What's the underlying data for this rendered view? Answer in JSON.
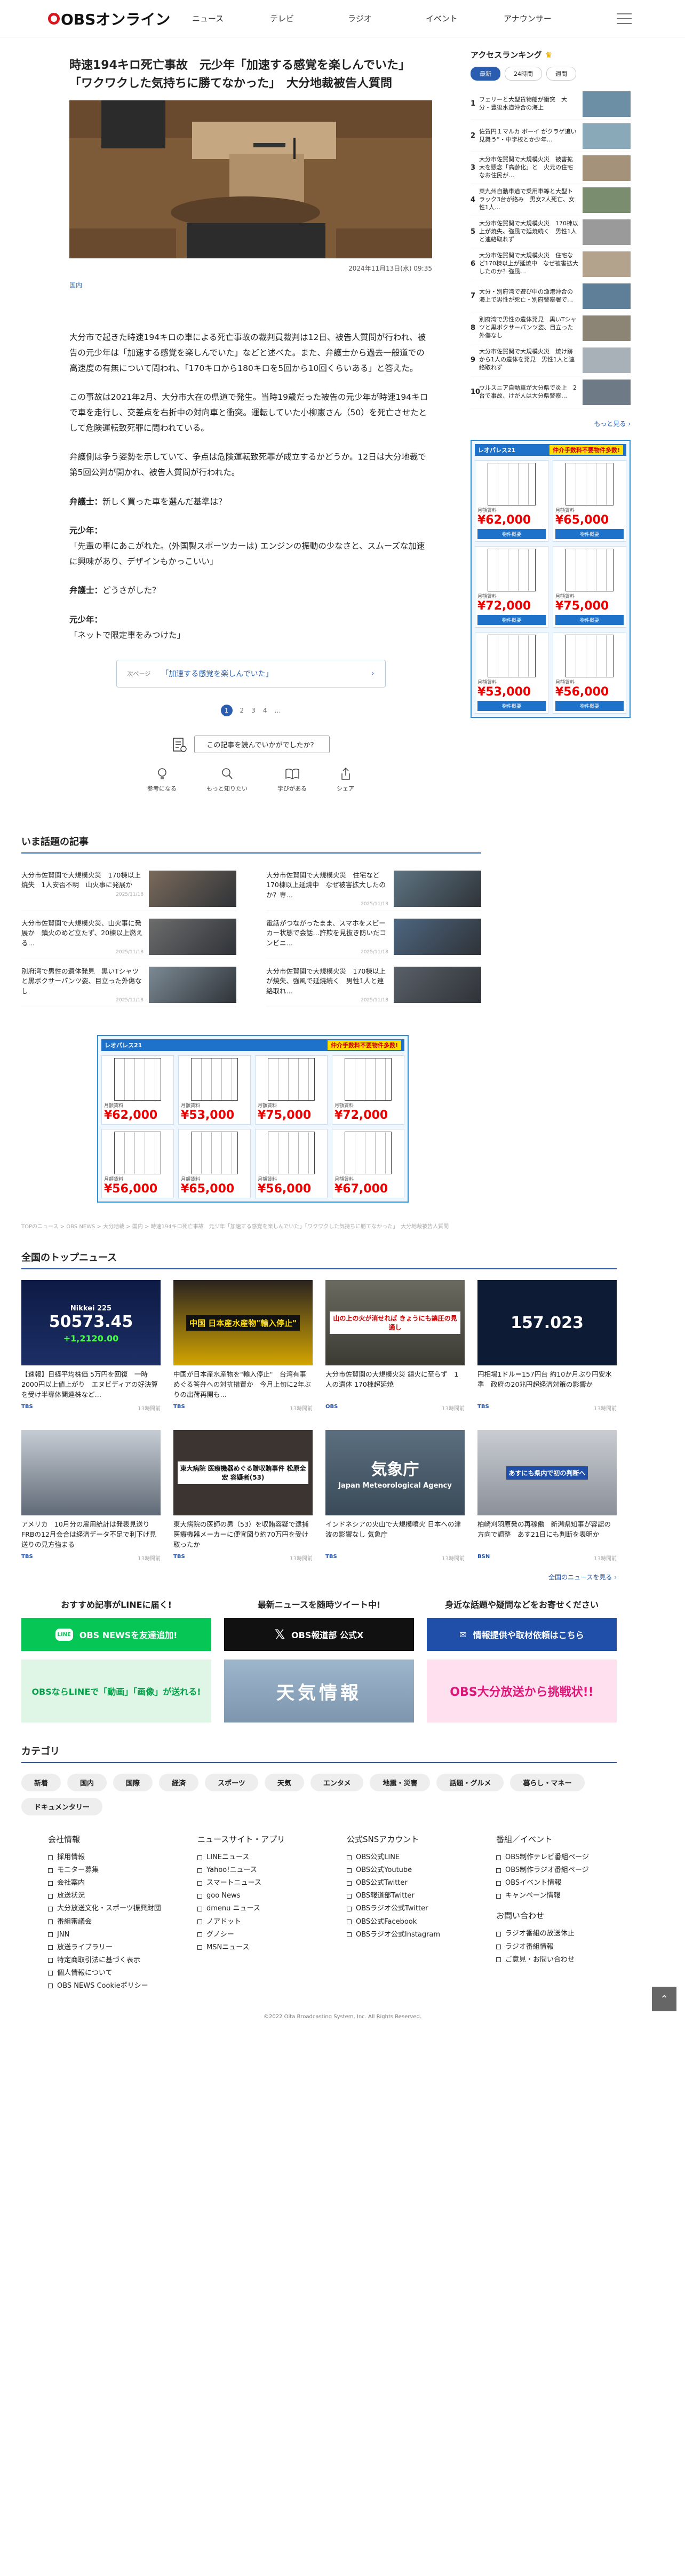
{
  "header": {
    "logo_text": "OBSオンライン",
    "nav": [
      "ニュース",
      "テレビ",
      "ラジオ",
      "イベント",
      "アナウンサー"
    ]
  },
  "article": {
    "title_line1": "時速194キロ死亡事故　元少年「加速する感覚を楽しんでいた」",
    "title_line2": "「ワクワクした気持ちに勝てなかった」　大分地裁被告人質問",
    "date": "2024年11月13日(水) 09:35",
    "category": "国内",
    "paragraphs": [
      "大分市で起きた時速194キロの車による死亡事故の裁判員裁判は12日、被告人質問が行われ、被告の元少年は「加速する感覚を楽しんでいた」などと述べた。また、弁護士から過去一般道での高速度の有無について問われ、「170キロから180キロを5回から10回くらいある」と答えた。",
      "この事故は2021年2月、大分市大在の県道で発生。当時19歳だった被告の元少年が時速194キロで車を走行し、交差点を右折中の対向車と衝突。運転していた小柳憲さん（50）を死亡させたとして危険運転致死罪に問われている。",
      "弁護側は争う姿勢を示していて、争点は危険運転致死罪が成立するかどうか。12日は大分地裁で第5回公判が開かれ、被告人質問が行われた。"
    ],
    "dialog": [
      {
        "speaker": "弁護士：",
        "text": "新しく買った車を選んだ基準は？"
      },
      {
        "speaker": "元少年：",
        "text": "「先輩の車にあこがれた。(外国製スポーツカーは) エンジンの振動の少なさと、スムーズな加速に興味があり、デザインもかっこいい」"
      },
      {
        "speaker": "弁護士：",
        "text": "どうさがした？"
      },
      {
        "speaker": "元少年：",
        "text": "「ネットで限定車をみつけた」"
      }
    ],
    "next_label": "次ページ",
    "next_title": "「加速する感覚を楽しんでいた」",
    "pages": [
      "1",
      "2",
      "3",
      "4",
      "…"
    ],
    "survey_label": "この記事を読んでいかがでしたか？",
    "reactions": [
      "参考になる",
      "もっと知りたい",
      "学びがある",
      "シェア"
    ]
  },
  "ranking": {
    "title": "アクセスランキング",
    "tabs": [
      "最新",
      "24時間",
      "週間"
    ],
    "items": [
      {
        "n": "1",
        "t": "フェリーと大型貨物船が衝突　大分・豊後水道沖合の海上"
      },
      {
        "n": "2",
        "t": "佐賀円１マルカ ボーイ がクラゲ追い見舞う”・中学校とか少年…"
      },
      {
        "n": "3",
        "t": "大分市佐賀関で大規模火災　被害拡大を懸念「高齢化」と　火元の住宅なお住民が…"
      },
      {
        "n": "4",
        "t": "東九州自動車道で乗用車等と大型トラック3台が絡み　男女2人死亡、女性1人…"
      },
      {
        "n": "5",
        "t": "大分市佐賀関で大規模火災　170棟以上が焼失、強風で延焼続く　男性1人と連絡取れず"
      },
      {
        "n": "6",
        "t": "大分市佐賀関で大規模火災　住宅など170棟以上が延焼中　なぜ被害拡大したのか？強風…"
      },
      {
        "n": "7",
        "t": "大分・別府湾で遊び中の漁港沖合の海上で男性が死亡・別府警察署で…"
      },
      {
        "n": "8",
        "t": "別府湾で男性の遺体発見　黒いTシャツと黒ボクサーパンツ姿、目立った外傷なし"
      },
      {
        "n": "9",
        "t": "大分市佐賀関で大規模火災　焼け跡から1人の遺体を発見　男性1人と連絡取れず"
      },
      {
        "n": "10",
        "t": "ウルスニア自動車が大分県で炎上　2台で事故、けが人は大分県警察…"
      }
    ],
    "more": "もっと見る"
  },
  "ad_side": {
    "brand": "レオパレス21",
    "promo": "仲介手数料不要物件多数!",
    "price_label": "月額賃料",
    "items": [
      "¥62,000",
      "¥65,000",
      "¥72,000",
      "¥75,000",
      "¥53,000",
      "¥56,000"
    ],
    "button": "物件概要"
  },
  "hot": {
    "title": "いま話題の記事",
    "items": [
      {
        "t": "大分市佐賀関で大規模火災　170棟以上焼失　1人安否不明　山火事に発展か",
        "d": "2025/11/18"
      },
      {
        "t": "大分市佐賀関で大規模火災　住宅など170棟以上延焼中　なぜ被害拡大したのか？専…",
        "d": "2025/11/18"
      },
      {
        "t": "大分市佐賀関で大規模火災、山火事に発展か　鎮火のめど立たず、20棟以上燃える…",
        "d": "2025/11/18"
      },
      {
        "t": "電話がつながったまま、スマホをスピーカー状態で会話…許欺を見抜き防いだコンビニ…",
        "d": "2025/11/18"
      },
      {
        "t": "別府湾で男性の遺体発見　黒いTシャツと黒ボクサーパンツ姿、目立った外傷なし",
        "d": "2025/11/18"
      },
      {
        "t": "大分市佐賀関で大規模火災　170棟以上が焼失、強風で延焼続く　男性1人と連絡取れ…",
        "d": "2025/11/18"
      }
    ]
  },
  "ad_main": {
    "brand": "レオパレス21",
    "promo": "仲介手数料不要物件多数!",
    "price_label": "月額賃料",
    "items": [
      "¥62,000",
      "¥53,000",
      "¥75,000",
      "¥72,000",
      "¥56,000",
      "¥65,000",
      "¥56,000",
      "¥67,000"
    ]
  },
  "breadcrumb": "TOPのニュース > OBS NEWS > 大分地裁 > 国内 > 時速194キロ死亡事故　元少年「加速する感覚を楽しんでいた」「ワクワクした気持ちに勝てなかった」　大分地裁被告人質問",
  "topnews": {
    "title": "全国のトップニュース",
    "items": [
      {
        "t": "【速報】日経平均株価 5万円を回復　一時2000円以上値上がり　エヌビディアの好決算を受け半導体関連株など…",
        "src": "TBS",
        "ago": "13時間前",
        "img_text": "50573.45",
        "img_sub": "Nikkei 225",
        "img_delta": "+1,2120.00"
      },
      {
        "t": "中国が日本産水産物を\"輸入停止\"　台湾有事めぐる答弁への対抗措置か　今月上旬に2年ぶりの出荷再開も…",
        "src": "TBS",
        "ago": "13時間前",
        "img_text": "中国 日本産水産物\"輸入停止\"",
        "img_sub": "",
        "img_delta": ""
      },
      {
        "t": "大分市佐賀関の大規模火災 鎮火に至らず　1人の遺体 170棟超延焼",
        "src": "OBS",
        "ago": "13時間前",
        "img_text": "山の上の火が消せれば きょうにも鎮圧の見通し",
        "img_sub": "",
        "img_delta": ""
      },
      {
        "t": "円相場1ドル＝157円台 約10か月ぶり円安水準　政府の20兆円超経済対策の影響か",
        "src": "TBS",
        "ago": "13時間前",
        "img_text": "157.023",
        "img_sub": "",
        "img_delta": ""
      },
      {
        "t": "アメリカ　10月分の雇用統計は発表見送り　FRBの12月会合は経済データ不足で利下げ見送りの見方強まる",
        "src": "TBS",
        "ago": "13時間前",
        "img_text": "",
        "img_sub": "",
        "img_delta": ""
      },
      {
        "t": "東大病院の医師の男（53）を収賄容疑で逮捕　医療機器メーカーに便宜図り約70万円を受け取ったか",
        "src": "TBS",
        "ago": "13時間前",
        "img_text": "東大病院 医療機器めぐる贈収賄事件 松原全宏 容疑者(53)",
        "img_sub": "",
        "img_delta": ""
      },
      {
        "t": "インドネシアの火山で大規模噴火 日本への津波の影響なし 気象庁",
        "src": "TBS",
        "ago": "13時間前",
        "img_text": "気象庁",
        "img_sub": "Japan Meteorological Agency",
        "img_delta": ""
      },
      {
        "t": "柏崎刈羽原発の再稼働　新潟県知事が容認の方向で調整　あす21日にも判断を表明か",
        "src": "BSN",
        "ago": "13時間前",
        "img_text": "あすにも県内で初の判断へ",
        "img_sub": "",
        "img_delta": ""
      }
    ],
    "more": "全国のニュースを見る"
  },
  "banners": [
    {
      "h": "おすすめ記事がLINEに届く!",
      "b": "OBS NEWSを友達追加!",
      "img": "OBSならLINEで「動画」「画像」が送れる!"
    },
    {
      "h": "最新ニュースを随時ツイート中!",
      "b": "OBS報道部 公式X",
      "img": "天気情報"
    },
    {
      "h": "身近な話題や疑問などをお寄せください",
      "b": "情報提供や取材依頼はこちら",
      "img": "OBS大分放送から挑戦状!!"
    }
  ],
  "categories": {
    "title": "カテゴリ",
    "items": [
      "新着",
      "国内",
      "国際",
      "経済",
      "スポーツ",
      "天気",
      "エンタメ",
      "地震・災害",
      "話題・グルメ",
      "暮らし・マネー",
      "ドキュメンタリー"
    ]
  },
  "footer": {
    "cols": [
      {
        "h": "会社情報",
        "items": [
          "採用情報",
          "モニター募集",
          "会社案内",
          "放送状況",
          "大分放送文化・スポーツ振興財団",
          "番組審議会",
          "JNN",
          "放送ライブラリー",
          "特定商取引法に基づく表示",
          "個人情報について",
          "OBS NEWS Cookieポリシー"
        ]
      },
      {
        "h": "ニュースサイト・アプリ",
        "items": [
          "LINEニュース",
          "Yahoo!ニュース",
          "スマートニュース",
          "goo News",
          "dmenu ニュース",
          "ノアドット",
          "グノシー",
          "MSNニュース"
        ]
      },
      {
        "h": "公式SNSアカウント",
        "items": [
          "OBS公式LINE",
          "OBS公式Youtube",
          "OBS公式Twitter",
          "OBS報道部Twitter",
          "OBSラジオ公式Twitter",
          "OBS公式Facebook",
          "OBSラジオ公式Instagram"
        ]
      },
      {
        "h": "番組／イベント",
        "items": [
          "OBS制作テレビ番組ページ",
          "OBS制作ラジオ番組ページ",
          "OBSイベント情報",
          "キャンペーン情報"
        ],
        "h2": "お問い合わせ",
        "items2": [
          "ラジオ番組の放送休止",
          "ラジオ番組情報",
          "ご意見・お問い合わせ"
        ]
      }
    ],
    "copyright": "©2022 Oita Broadcasting System, Inc. All Rights Reserved."
  },
  "colors": {
    "brand": "#d9141c",
    "accent": "#2a5db0",
    "line": "#06c755"
  }
}
